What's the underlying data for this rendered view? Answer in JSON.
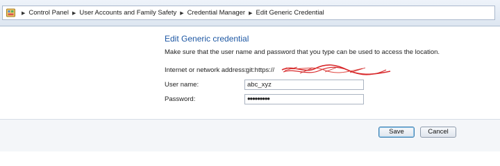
{
  "breadcrumb": {
    "items": [
      "Control Panel",
      "User Accounts and Family Safety",
      "Credential Manager",
      "Edit Generic Credential"
    ]
  },
  "form": {
    "title": "Edit Generic credential",
    "description": "Make sure that the user name and password that you type can be used to access the location.",
    "address_label": "Internet or network address:",
    "address_value": "git:https://",
    "username_label": "User name:",
    "username_value": "abc_xyz",
    "password_label": "Password:",
    "password_value": "•••••••••"
  },
  "buttons": {
    "save_label": "Save",
    "cancel_label": "Cancel"
  },
  "colors": {
    "title_blue": "#1d57a3",
    "scribble_red": "#d8282b"
  },
  "icons": {
    "control_panel": "control-panel-icon",
    "separator": "triangle-right-icon"
  }
}
